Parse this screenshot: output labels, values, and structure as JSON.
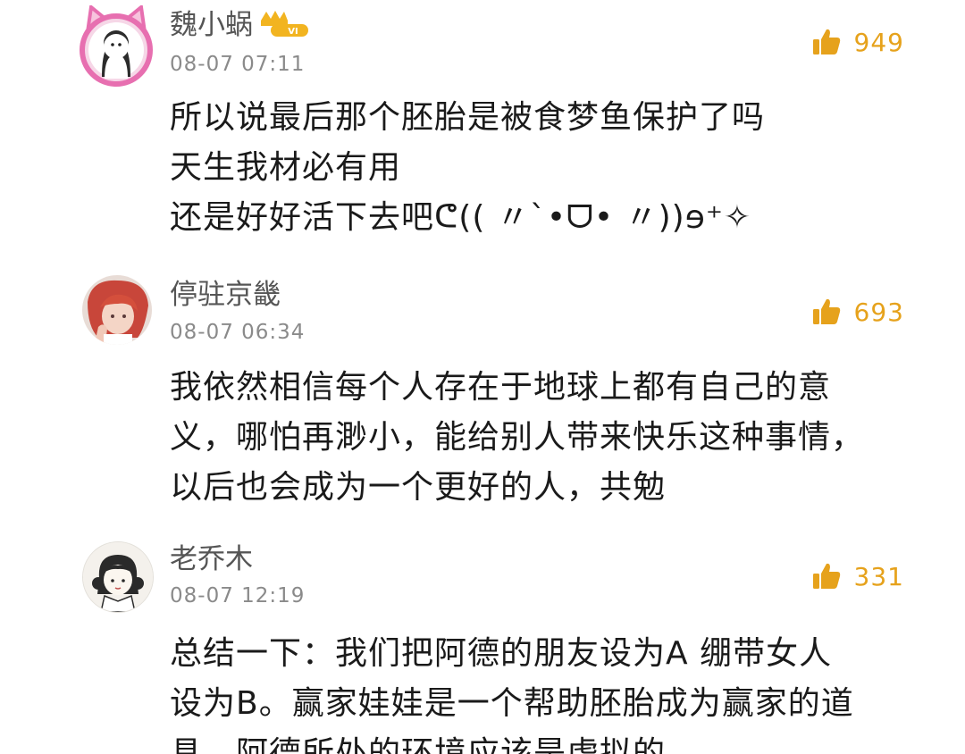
{
  "comments": [
    {
      "username": "魏小蜗",
      "vip_badge": "VI",
      "timestamp": "08-07 07:11",
      "likes": "949",
      "lines": [
        "所以说最后那个胚胎是被食梦鱼保护了吗",
        "天生我材必有用",
        "还是好好活下去吧ᕦ(( 〃`•ᗜ• 〃))ɘ⁺✧"
      ]
    },
    {
      "username": "停驻京畿",
      "timestamp": "08-07 06:34",
      "likes": "693",
      "lines": [
        "我依然相信每个人存在于地球上都有自己的意",
        "义，哪怕再渺小，能给别人带来快乐这种事情，",
        "以后也会成为一个更好的人，共勉"
      ]
    },
    {
      "username": "老乔木",
      "timestamp": "08-07 12:19",
      "likes": "331",
      "lines": [
        "总结一下：我们把阿德的朋友设为A 绷带女人",
        "设为B。赢家娃娃是一个帮助胚胎成为赢家的道",
        "具。阿德所处的环境应该是虚拟的。"
      ]
    }
  ],
  "colors": {
    "like_accent": "#e6a21c",
    "username": "#555555",
    "timestamp": "#8a8a8a",
    "body_text": "#1a1a1a",
    "avatar_frame_pink": "#e76fb0"
  },
  "icons": [
    "thumbs-up-icon",
    "crown-icon",
    "cat-ear-frame"
  ]
}
